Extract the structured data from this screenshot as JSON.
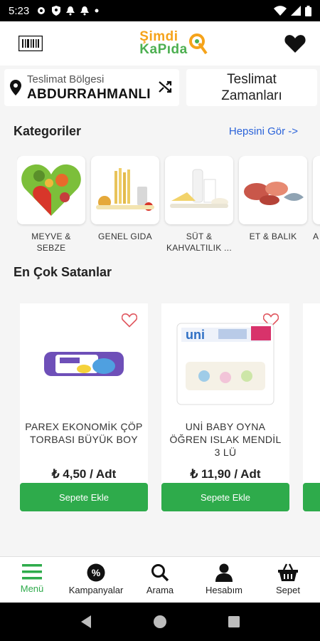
{
  "status_bar": {
    "time": "5:23"
  },
  "header": {
    "logo_line1": "Şimdi",
    "logo_line2": "KaPıda"
  },
  "delivery": {
    "region_label": "Teslimat Bölgesi",
    "region_value": "ABDURRAHMANLI",
    "time_line1": "Teslimat",
    "time_line2": "Zamanları"
  },
  "categories_section": {
    "title": "Kategoriler",
    "see_all": "Hepsini Gör ->",
    "items": [
      {
        "line1": "MEYVE &",
        "line2": "SEBZE"
      },
      {
        "line1": "GENEL GIDA",
        "line2": ""
      },
      {
        "line1": "SÜT &",
        "line2": "KAHVALTILIK ..."
      },
      {
        "line1": "ET & BALIK",
        "line2": ""
      },
      {
        "line1": "A",
        "line2": ""
      }
    ]
  },
  "bestsellers": {
    "title": "En Çok Satanlar",
    "products": [
      {
        "name": "PAREX EKONOMİK ÇÖP TORBASI BÜYÜK BOY",
        "price": "₺ 4,50 / Adt",
        "button": "Sepete Ekle"
      },
      {
        "name": "UNİ BABY OYNA ÖĞREN ISLAK MENDİL 3 LÜ",
        "price": "₺ 11,90 / Adt",
        "button": "Sepete Ekle"
      }
    ]
  },
  "bottom_nav": [
    {
      "label": "Menü",
      "icon": "menu-icon",
      "active": true
    },
    {
      "label": "Kampanyalar",
      "icon": "percent-badge-icon",
      "active": false
    },
    {
      "label": "Arama",
      "icon": "search-icon",
      "active": false
    },
    {
      "label": "Hesabım",
      "icon": "person-icon",
      "active": false
    },
    {
      "label": "Sepet",
      "icon": "basket-icon",
      "active": false
    }
  ],
  "colors": {
    "brand_green": "#2eab4b",
    "brand_orange": "#f5a31a",
    "link_blue": "#2b63d9"
  }
}
